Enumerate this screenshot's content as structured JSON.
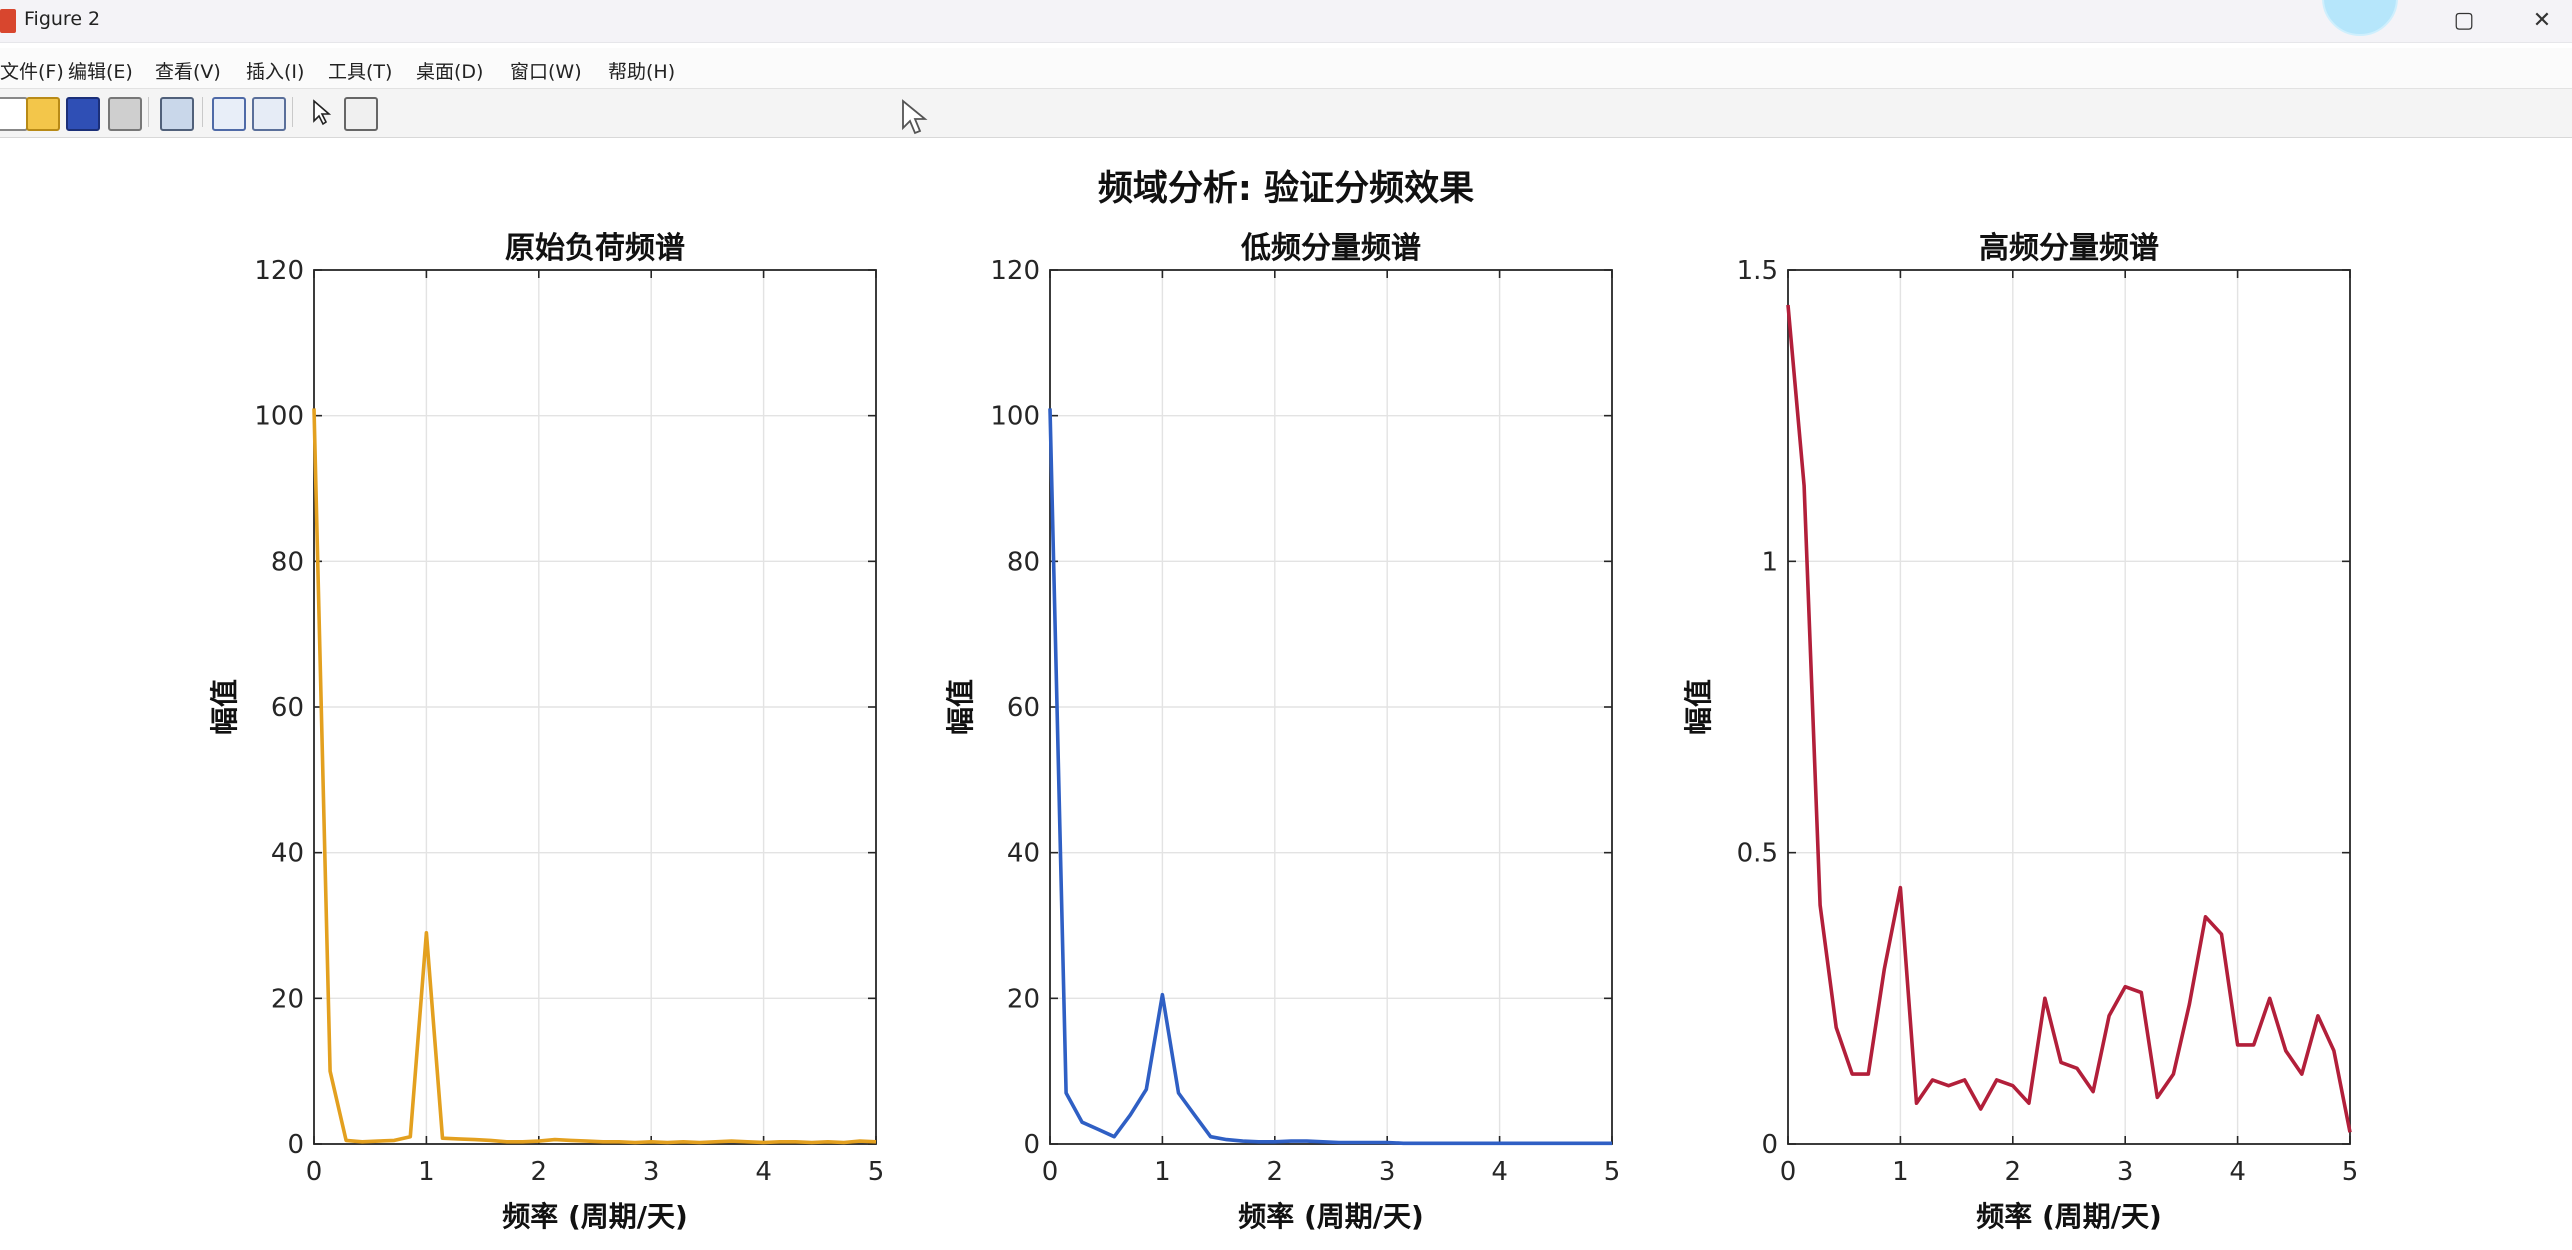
{
  "window": {
    "title": "Figure 2",
    "minimize_glyph": "▢",
    "close_glyph": "✕"
  },
  "menu": [
    "文件(F)",
    "编辑(E)",
    "查看(V)",
    "插入(I)",
    "工具(T)",
    "桌面(D)",
    "窗口(W)",
    "帮助(H)"
  ],
  "toolbar": {
    "icons": [
      "new-figure-icon",
      "open-file-icon",
      "save-icon",
      "print-icon",
      "zoom-icon",
      "link-icon",
      "insert-colorbar-icon",
      "edit-plot-icon",
      "property-inspector-icon"
    ]
  },
  "figure": {
    "title": "频域分析: 验证分频效果"
  },
  "chart_data": [
    {
      "type": "line",
      "title": "原始负荷频谱",
      "xlabel": "频率 (周期/天)",
      "ylabel": "幅值",
      "xlim": [
        0,
        5
      ],
      "ylim": [
        0,
        120
      ],
      "xticks": [
        0,
        1,
        2,
        3,
        4,
        5
      ],
      "xtick_labels": [
        "0",
        "1",
        "2",
        "3",
        "4",
        "5"
      ],
      "yticks": [
        0,
        20,
        40,
        60,
        80,
        100,
        120
      ],
      "ytick_labels": [
        "0",
        "20",
        "40",
        "60",
        "80",
        "100",
        "120"
      ],
      "grid": true,
      "color": "#e3a01f",
      "series": [
        {
          "x": [
            0,
            0.143,
            0.286,
            0.429,
            0.571,
            0.714,
            0.857,
            1.0,
            1.143,
            1.286,
            1.429,
            1.571,
            1.714,
            1.857,
            2.0,
            2.143,
            2.286,
            2.429,
            2.571,
            2.714,
            2.857,
            3.0,
            3.143,
            3.286,
            3.429,
            3.571,
            3.714,
            3.857,
            4.0,
            4.143,
            4.286,
            4.429,
            4.571,
            4.714,
            4.857,
            5.0
          ],
          "y": [
            101,
            10,
            0.5,
            0.3,
            0.4,
            0.5,
            1,
            29,
            0.8,
            0.7,
            0.6,
            0.5,
            0.3,
            0.3,
            0.4,
            0.6,
            0.5,
            0.4,
            0.3,
            0.3,
            0.2,
            0.3,
            0.2,
            0.3,
            0.2,
            0.3,
            0.4,
            0.3,
            0.2,
            0.3,
            0.3,
            0.2,
            0.3,
            0.2,
            0.4,
            0.3
          ]
        }
      ]
    },
    {
      "type": "line",
      "title": "低频分量频谱",
      "xlabel": "频率 (周期/天)",
      "ylabel": "幅值",
      "xlim": [
        0,
        5
      ],
      "ylim": [
        0,
        120
      ],
      "xticks": [
        0,
        1,
        2,
        3,
        4,
        5
      ],
      "xtick_labels": [
        "0",
        "1",
        "2",
        "3",
        "4",
        "5"
      ],
      "yticks": [
        0,
        20,
        40,
        60,
        80,
        100,
        120
      ],
      "ytick_labels": [
        "0",
        "20",
        "40",
        "60",
        "80",
        "100",
        "120"
      ],
      "grid": true,
      "color": "#2f5fc4",
      "series": [
        {
          "x": [
            0,
            0.143,
            0.286,
            0.429,
            0.571,
            0.714,
            0.857,
            1.0,
            1.143,
            1.286,
            1.429,
            1.571,
            1.714,
            1.857,
            2.0,
            2.143,
            2.286,
            2.429,
            2.571,
            2.714,
            2.857,
            3.0,
            3.143,
            3.286,
            3.429,
            3.571,
            3.714,
            3.857,
            4.0,
            4.143,
            4.286,
            4.429,
            4.571,
            4.714,
            4.857,
            5.0
          ],
          "y": [
            101,
            7,
            3,
            2,
            1,
            4,
            7.5,
            20.5,
            7,
            4,
            1,
            0.6,
            0.4,
            0.3,
            0.3,
            0.4,
            0.4,
            0.3,
            0.2,
            0.2,
            0.2,
            0.2,
            0.1,
            0.1,
            0.1,
            0.1,
            0.1,
            0.1,
            0.1,
            0.1,
            0.1,
            0.1,
            0.1,
            0.1,
            0.1,
            0.1
          ]
        }
      ]
    },
    {
      "type": "line",
      "title": "高频分量频谱",
      "xlabel": "频率 (周期/天)",
      "ylabel": "幅值",
      "xlim": [
        0,
        5
      ],
      "ylim": [
        0,
        1.5
      ],
      "xticks": [
        0,
        1,
        2,
        3,
        4,
        5
      ],
      "xtick_labels": [
        "0",
        "1",
        "2",
        "3",
        "4",
        "5"
      ],
      "yticks": [
        0,
        0.5,
        1,
        1.5
      ],
      "ytick_labels": [
        "0",
        "0.5",
        "1",
        "1.5"
      ],
      "grid": true,
      "color": "#b21f3a",
      "series": [
        {
          "x": [
            0,
            0.143,
            0.286,
            0.429,
            0.571,
            0.714,
            0.857,
            1.0,
            1.143,
            1.286,
            1.429,
            1.571,
            1.714,
            1.857,
            2.0,
            2.143,
            2.286,
            2.429,
            2.571,
            2.714,
            2.857,
            3.0,
            3.143,
            3.286,
            3.429,
            3.571,
            3.714,
            3.857,
            4.0,
            4.143,
            4.286,
            4.429,
            4.571,
            4.714,
            4.857,
            5.0
          ],
          "y": [
            1.44,
            1.13,
            0.41,
            0.2,
            0.12,
            0.12,
            0.3,
            0.44,
            0.07,
            0.11,
            0.1,
            0.11,
            0.06,
            0.11,
            0.1,
            0.07,
            0.25,
            0.14,
            0.13,
            0.09,
            0.22,
            0.27,
            0.26,
            0.08,
            0.12,
            0.24,
            0.39,
            0.36,
            0.17,
            0.17,
            0.25,
            0.16,
            0.12,
            0.22,
            0.16,
            0.02
          ]
        }
      ]
    }
  ]
}
